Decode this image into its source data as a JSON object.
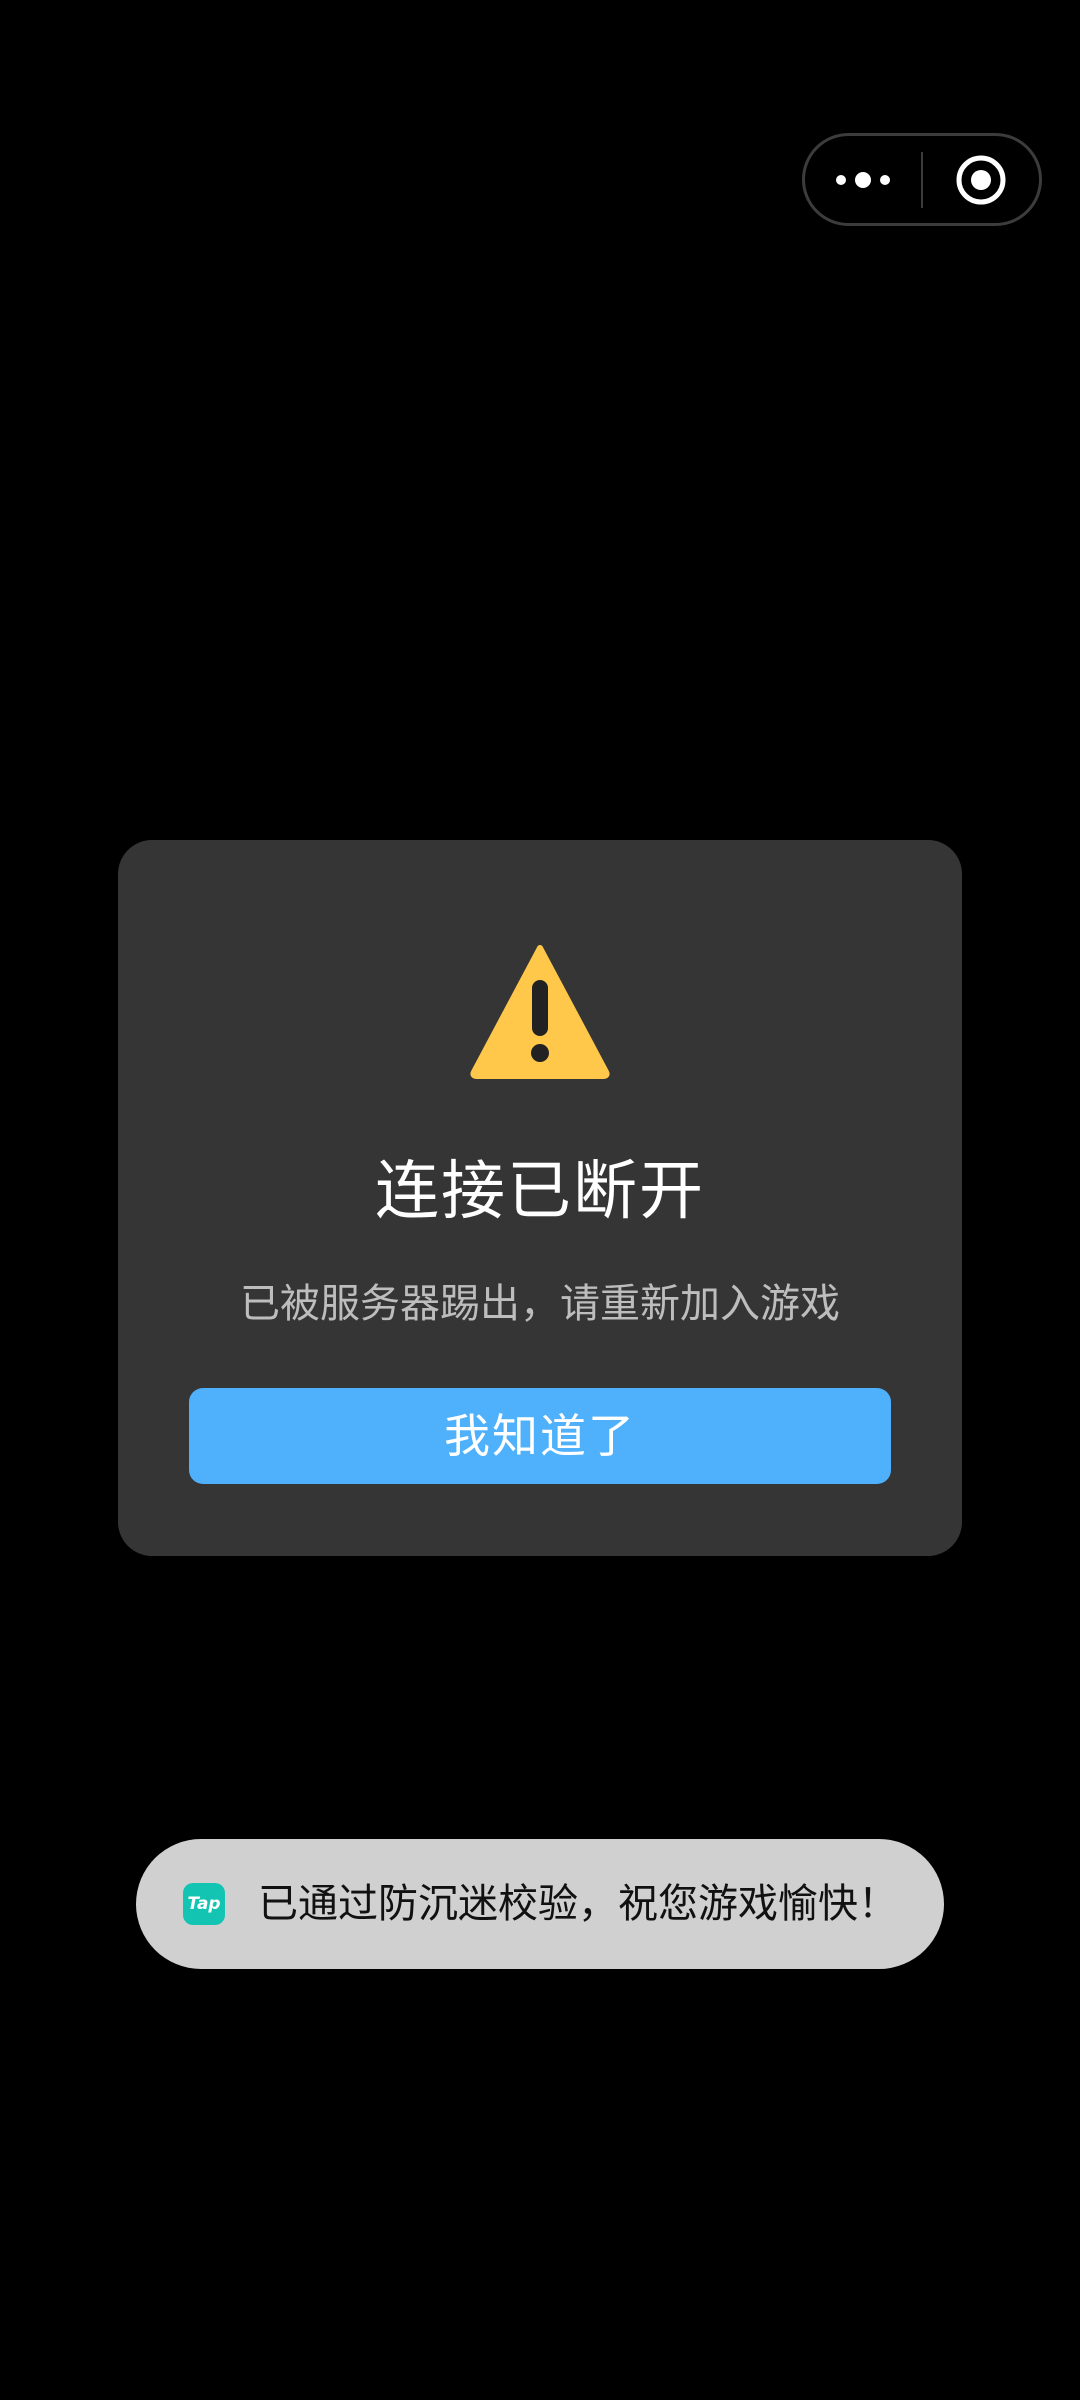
{
  "capsule": {
    "more_icon": "more-dots-icon",
    "close_icon": "target-circle-icon"
  },
  "dialog": {
    "icon": "warning-triangle-icon",
    "icon_color": "#FFC84B",
    "title": "连接已断开",
    "message": "已被服务器踢出，请重新加入游戏",
    "confirm_label": "我知道了",
    "confirm_color": "#4FB0FB"
  },
  "toast": {
    "logo_text": "Tap",
    "logo_color": "#14C4B2",
    "message": "已通过防沉迷校验，祝您游戏愉快！"
  }
}
